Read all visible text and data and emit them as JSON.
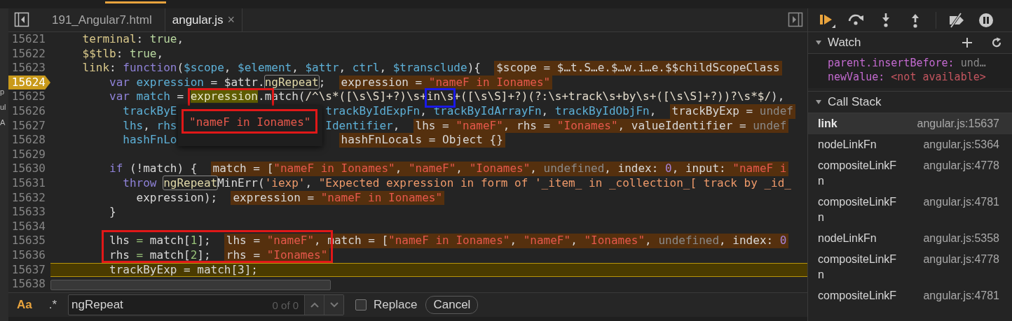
{
  "left_panel_fragments": [
    "p",
    "ul",
    "A"
  ],
  "tabs": [
    {
      "label": "191_Angular7.html",
      "selected": false
    },
    {
      "label": "angular.js",
      "selected": true,
      "close": "×"
    }
  ],
  "editor": {
    "lines": [
      {
        "number": "15621",
        "breakpoint": false,
        "current": false,
        "code": [
          {
            "text": "    terminal",
            "kind": "prop"
          },
          {
            "text": ": ",
            "kind": "plain"
          },
          {
            "text": "true",
            "kind": "atom"
          },
          {
            "text": ",",
            "kind": "plain"
          }
        ]
      },
      {
        "number": "15622",
        "breakpoint": false,
        "current": false,
        "code": [
          {
            "text": "    $$tlb",
            "kind": "prop"
          },
          {
            "text": ": ",
            "kind": "plain"
          },
          {
            "text": "true",
            "kind": "atom"
          },
          {
            "text": ",",
            "kind": "plain"
          }
        ]
      },
      {
        "number": "15623",
        "breakpoint": false,
        "current": false,
        "code": [
          {
            "text": "    link",
            "kind": "prop"
          },
          {
            "text": ": ",
            "kind": "plain"
          },
          {
            "text": "function",
            "kind": "kw"
          },
          {
            "text": "(",
            "kind": "plain"
          },
          {
            "text": "$scope",
            "kind": "def"
          },
          {
            "text": ", ",
            "kind": "plain"
          },
          {
            "text": "$element",
            "kind": "def"
          },
          {
            "text": ", ",
            "kind": "plain"
          },
          {
            "text": "$attr",
            "kind": "def"
          },
          {
            "text": ", ",
            "kind": "plain"
          },
          {
            "text": "ctrl",
            "kind": "def"
          },
          {
            "text": ", ",
            "kind": "plain"
          },
          {
            "text": "$transclude",
            "kind": "def"
          },
          {
            "text": "){",
            "kind": "plain"
          }
        ],
        "inline": [
          {
            "text": "$scope = $…t.S…e.$…w.i…e.$$childScopeClass",
            "kind": "plain"
          }
        ]
      },
      {
        "number": "15624",
        "breakpoint": true,
        "current": false,
        "code": [
          {
            "text": "        var",
            "kind": "kw"
          },
          {
            "text": " expression",
            "kind": "def"
          },
          {
            "text": " = $attr.",
            "kind": "plain"
          },
          {
            "text": "ngRepeat",
            "kind": "match"
          },
          {
            "text": ";",
            "kind": "plain"
          }
        ],
        "inline": [
          {
            "text": "expression = ",
            "kind": "plain"
          },
          {
            "text": "\"nameF in Ionames\"",
            "kind": "strv"
          }
        ]
      },
      {
        "number": "15625",
        "breakpoint": false,
        "current": false,
        "code": [
          {
            "text": "        var",
            "kind": "kw"
          },
          {
            "text": " match",
            "kind": "def"
          },
          {
            "text": " = ",
            "kind": "plain"
          },
          {
            "text": "expression",
            "kind": "hover"
          },
          {
            "text": ".match(",
            "kind": "plain"
          },
          {
            "text": "/^\\s*([\\s\\S]+?)\\s+in\\s+([\\s\\S]+?)(?:\\s+track\\s+by\\s+([\\s\\S]+?))?\\s*$/",
            "kind": "regex"
          },
          {
            "text": "),",
            "kind": "plain"
          }
        ]
      },
      {
        "number": "15626",
        "breakpoint": false,
        "current": false,
        "under_popover": true,
        "code": [
          {
            "text": "          trackByE",
            "kind": "def"
          }
        ],
        "code_after_popover": [
          {
            "text": "trackByIdExpFn",
            "kind": "def"
          },
          {
            "text": ", ",
            "kind": "plain"
          },
          {
            "text": "trackByIdArrayFn",
            "kind": "def"
          },
          {
            "text": ", ",
            "kind": "plain"
          },
          {
            "text": "trackByIdObjFn",
            "kind": "def"
          },
          {
            "text": ",",
            "kind": "plain"
          }
        ],
        "inline": [
          {
            "text": "trackByExp = ",
            "kind": "plain"
          },
          {
            "text": "undef",
            "kind": "undef"
          }
        ]
      },
      {
        "number": "15627",
        "breakpoint": false,
        "current": false,
        "under_popover": true,
        "code": [
          {
            "text": "          lhs",
            "kind": "def"
          },
          {
            "text": ", ",
            "kind": "plain"
          },
          {
            "text": "rhs",
            "kind": "def"
          }
        ],
        "code_after_popover": [
          {
            "text": "Identifier",
            "kind": "def"
          },
          {
            "text": ",",
            "kind": "plain"
          }
        ],
        "inline": [
          {
            "text": "lhs = ",
            "kind": "plain"
          },
          {
            "text": "\"nameF\"",
            "kind": "strv"
          },
          {
            "text": ", rhs = ",
            "kind": "plain"
          },
          {
            "text": "\"Ionames\"",
            "kind": "strv"
          },
          {
            "text": ", valueIdentifier = ",
            "kind": "plain"
          },
          {
            "text": "undef",
            "kind": "undef"
          }
        ]
      },
      {
        "number": "15628",
        "breakpoint": false,
        "current": false,
        "under_popover": true,
        "code": [
          {
            "text": "          hashFnLo",
            "kind": "def"
          }
        ],
        "inline": [
          {
            "text": "hashFnLocals = Object {}",
            "kind": "plain"
          }
        ]
      },
      {
        "number": "15629",
        "breakpoint": false,
        "current": false
      },
      {
        "number": "15630",
        "breakpoint": false,
        "current": false,
        "code": [
          {
            "text": "        if",
            "kind": "kw"
          },
          {
            "text": " (!match) {",
            "kind": "plain"
          }
        ],
        "inline": [
          {
            "text": "match = [",
            "kind": "plain"
          },
          {
            "text": "\"nameF in Ionames\"",
            "kind": "strv"
          },
          {
            "text": ", ",
            "kind": "plain"
          },
          {
            "text": "\"nameF\"",
            "kind": "strv"
          },
          {
            "text": ", ",
            "kind": "plain"
          },
          {
            "text": "\"Ionames\"",
            "kind": "strv"
          },
          {
            "text": ", ",
            "kind": "plain"
          },
          {
            "text": "undefined",
            "kind": "undef"
          },
          {
            "text": ", index: ",
            "kind": "plain"
          },
          {
            "text": "0",
            "kind": "numv"
          },
          {
            "text": ", input: ",
            "kind": "plain"
          },
          {
            "text": "\"nameF i",
            "kind": "strv"
          }
        ]
      },
      {
        "number": "15631",
        "breakpoint": false,
        "current": false,
        "code": [
          {
            "text": "          throw ",
            "kind": "kw"
          },
          {
            "text": "ngRepeat",
            "kind": "match"
          },
          {
            "text": "MinErr(",
            "kind": "plain"
          },
          {
            "text": "'iexp'",
            "kind": "str"
          },
          {
            "text": ", ",
            "kind": "plain"
          },
          {
            "text": "\"Expected expression in form of '_item_ in _collection_[ track by _id_",
            "kind": "str"
          }
        ]
      },
      {
        "number": "15632",
        "breakpoint": false,
        "current": false,
        "code": [
          {
            "text": "            expression);",
            "kind": "plain"
          }
        ],
        "inline": [
          {
            "text": "expression = ",
            "kind": "plain"
          },
          {
            "text": "\"nameF in Ionames\"",
            "kind": "strv"
          }
        ]
      },
      {
        "number": "15633",
        "breakpoint": false,
        "current": false,
        "code": [
          {
            "text": "        }",
            "kind": "plain"
          }
        ]
      },
      {
        "number": "15634",
        "breakpoint": false,
        "current": false
      },
      {
        "number": "15635",
        "breakpoint": false,
        "current": false,
        "code": [
          {
            "text": "        lhs ",
            "kind": "plain"
          },
          {
            "text": "=",
            "kind": "op"
          },
          {
            "text": " match[",
            "kind": "plain"
          },
          {
            "text": "1",
            "kind": "num"
          },
          {
            "text": "];",
            "kind": "plain"
          }
        ],
        "inline": [
          {
            "text": "lhs = ",
            "kind": "plain"
          },
          {
            "text": "\"nameF\"",
            "kind": "strv"
          },
          {
            "text": ", match = [",
            "kind": "plain"
          },
          {
            "text": "\"nameF in Ionames\"",
            "kind": "strv"
          },
          {
            "text": ", ",
            "kind": "plain"
          },
          {
            "text": "\"nameF\"",
            "kind": "strv"
          },
          {
            "text": ", ",
            "kind": "plain"
          },
          {
            "text": "\"Ionames\"",
            "kind": "strv"
          },
          {
            "text": ", ",
            "kind": "plain"
          },
          {
            "text": "undefined",
            "kind": "undef"
          },
          {
            "text": ", index: ",
            "kind": "plain"
          },
          {
            "text": "0",
            "kind": "numv"
          }
        ]
      },
      {
        "number": "15636",
        "breakpoint": false,
        "current": false,
        "code": [
          {
            "text": "        rhs ",
            "kind": "plain"
          },
          {
            "text": "=",
            "kind": "op"
          },
          {
            "text": " match[",
            "kind": "plain"
          },
          {
            "text": "2",
            "kind": "num"
          },
          {
            "text": "];",
            "kind": "plain"
          }
        ],
        "inline": [
          {
            "text": "rhs = ",
            "kind": "plain"
          },
          {
            "text": "\"Ionames\"",
            "kind": "strv"
          }
        ]
      },
      {
        "number": "15637",
        "breakpoint": false,
        "current": true,
        "code": [
          {
            "text": "        trackByExp = match[3];",
            "kind": "plain"
          }
        ]
      },
      {
        "number": "15638",
        "breakpoint": false,
        "current": false
      }
    ],
    "popover": {
      "value": "\"nameF in Ionames\""
    }
  },
  "search": {
    "case_sensitive": {
      "label": "Aa",
      "on": true
    },
    "regex": {
      "label": ".*",
      "on": false
    },
    "query": "ngRepeat",
    "count": "0 of 0",
    "replace": {
      "label": "Replace",
      "checked": false
    },
    "cancel": "Cancel"
  },
  "debugger": {
    "watch": {
      "title": "Watch",
      "expanded": true,
      "items": [
        {
          "name": "parent.insertBefore:",
          "value": "und…",
          "kind": "undefined"
        },
        {
          "name": "newValue:",
          "value": "<not available>",
          "kind": "unavailable"
        }
      ]
    },
    "call_stack": {
      "title": "Call Stack",
      "expanded": true,
      "frames": [
        {
          "name": "link",
          "location": "angular.js:15637",
          "selected": true
        },
        {
          "name": "nodeLinkFn",
          "location": "angular.js:5364",
          "selected": false
        },
        {
          "name": "compositeLinkFn",
          "location": "angular.js:4778",
          "selected": false
        },
        {
          "name": "compositeLinkFn",
          "location": "angular.js:4781",
          "selected": false
        },
        {
          "name": "nodeLinkFn",
          "location": "angular.js:5358",
          "selected": false
        },
        {
          "name": "compositeLinkFn",
          "location": "angular.js:4778",
          "selected": false
        },
        {
          "name": "compositeLinkF",
          "location": "angular.js:4781",
          "selected": false
        }
      ]
    }
  }
}
